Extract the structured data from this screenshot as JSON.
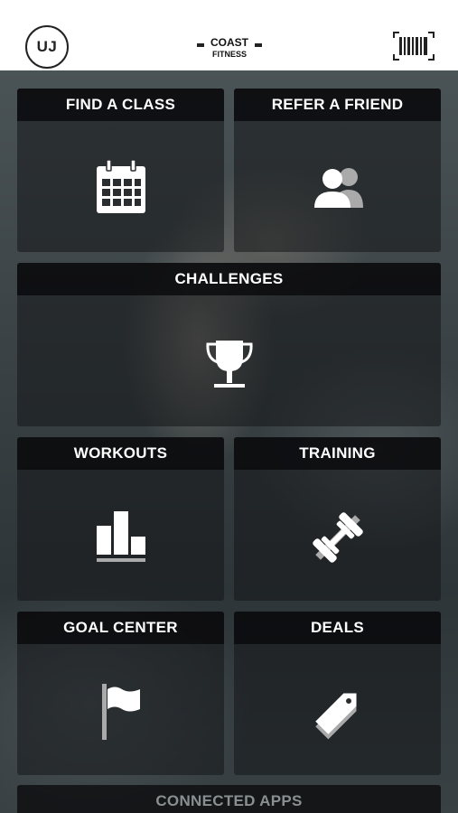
{
  "header": {
    "avatar_initials": "UJ",
    "logo_line1": "COAST",
    "logo_line2": "FITNESS"
  },
  "tiles": {
    "find_a_class": {
      "label": "FIND A CLASS",
      "icon": "calendar-icon"
    },
    "refer_a_friend": {
      "label": "REFER A FRIEND",
      "icon": "people-icon"
    },
    "challenges": {
      "label": "CHALLENGES",
      "icon": "trophy-icon"
    },
    "workouts": {
      "label": "WORKOUTS",
      "icon": "bar-chart-icon"
    },
    "training": {
      "label": "TRAINING",
      "icon": "dumbbell-icon"
    },
    "goal_center": {
      "label": "GOAL CENTER",
      "icon": "flag-icon"
    },
    "deals": {
      "label": "DEALS",
      "icon": "tag-icon"
    },
    "connected_apps": {
      "label": "CONNECTED APPS"
    }
  },
  "colors": {
    "header_bg": "#ffffff",
    "tile_title_bg": "#0a0a0c",
    "text": "#ffffff"
  }
}
